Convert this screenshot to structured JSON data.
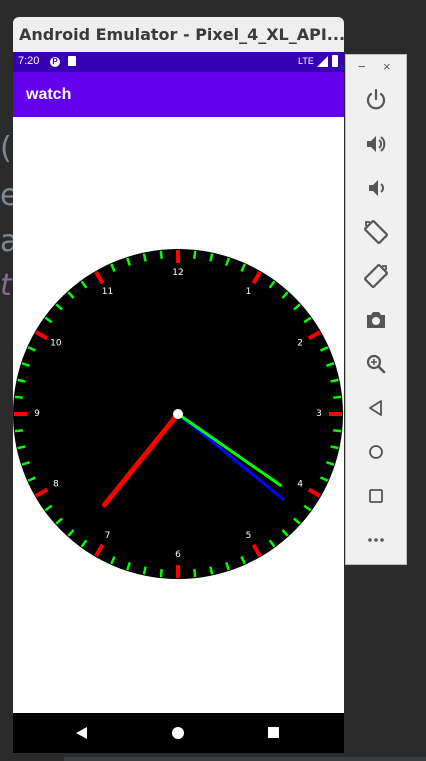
{
  "ide_background": {
    "glyphs": [
      "(",
      "e",
      "a",
      "t"
    ]
  },
  "emulator": {
    "window_title": "Android Emulator - Pixel_4_XL_API...",
    "status_bar": {
      "time": "7:20",
      "network": "LTE"
    },
    "app_bar": {
      "title": "watch"
    },
    "watch_face": {
      "numerals": [
        "12",
        "1",
        "2",
        "3",
        "4",
        "5",
        "6",
        "7",
        "8",
        "9",
        "10",
        "11"
      ],
      "hands": {
        "hour_hand_color": "#ff0000",
        "minute_hand_color": "#0000ff",
        "second_hand_color": "#00ff00",
        "hour_position_minutes": 36.5,
        "minute_position": 21.5,
        "second_position": 20.8
      },
      "colors": {
        "face": "#000000",
        "hour_tick": "#ff0000",
        "minute_tick": "#00ff00",
        "numeral": "#ffffff",
        "center_dot": "#ffffff"
      }
    },
    "nav_bar": {
      "buttons": [
        "back",
        "home",
        "recents"
      ]
    }
  },
  "side_toolbar": {
    "window_controls": {
      "minimize": "−",
      "close": "×"
    },
    "buttons": [
      {
        "name": "power-icon",
        "label": "Power"
      },
      {
        "name": "volume-up-icon",
        "label": "Volume up"
      },
      {
        "name": "volume-down-icon",
        "label": "Volume down"
      },
      {
        "name": "rotate-left-icon",
        "label": "Rotate left"
      },
      {
        "name": "rotate-right-icon",
        "label": "Rotate right"
      },
      {
        "name": "camera-icon",
        "label": "Take screenshot"
      },
      {
        "name": "zoom-icon",
        "label": "Zoom"
      },
      {
        "name": "back-icon",
        "label": "Back"
      },
      {
        "name": "home-icon",
        "label": "Home"
      },
      {
        "name": "overview-icon",
        "label": "Overview"
      },
      {
        "name": "more-icon",
        "label": "More"
      }
    ]
  }
}
